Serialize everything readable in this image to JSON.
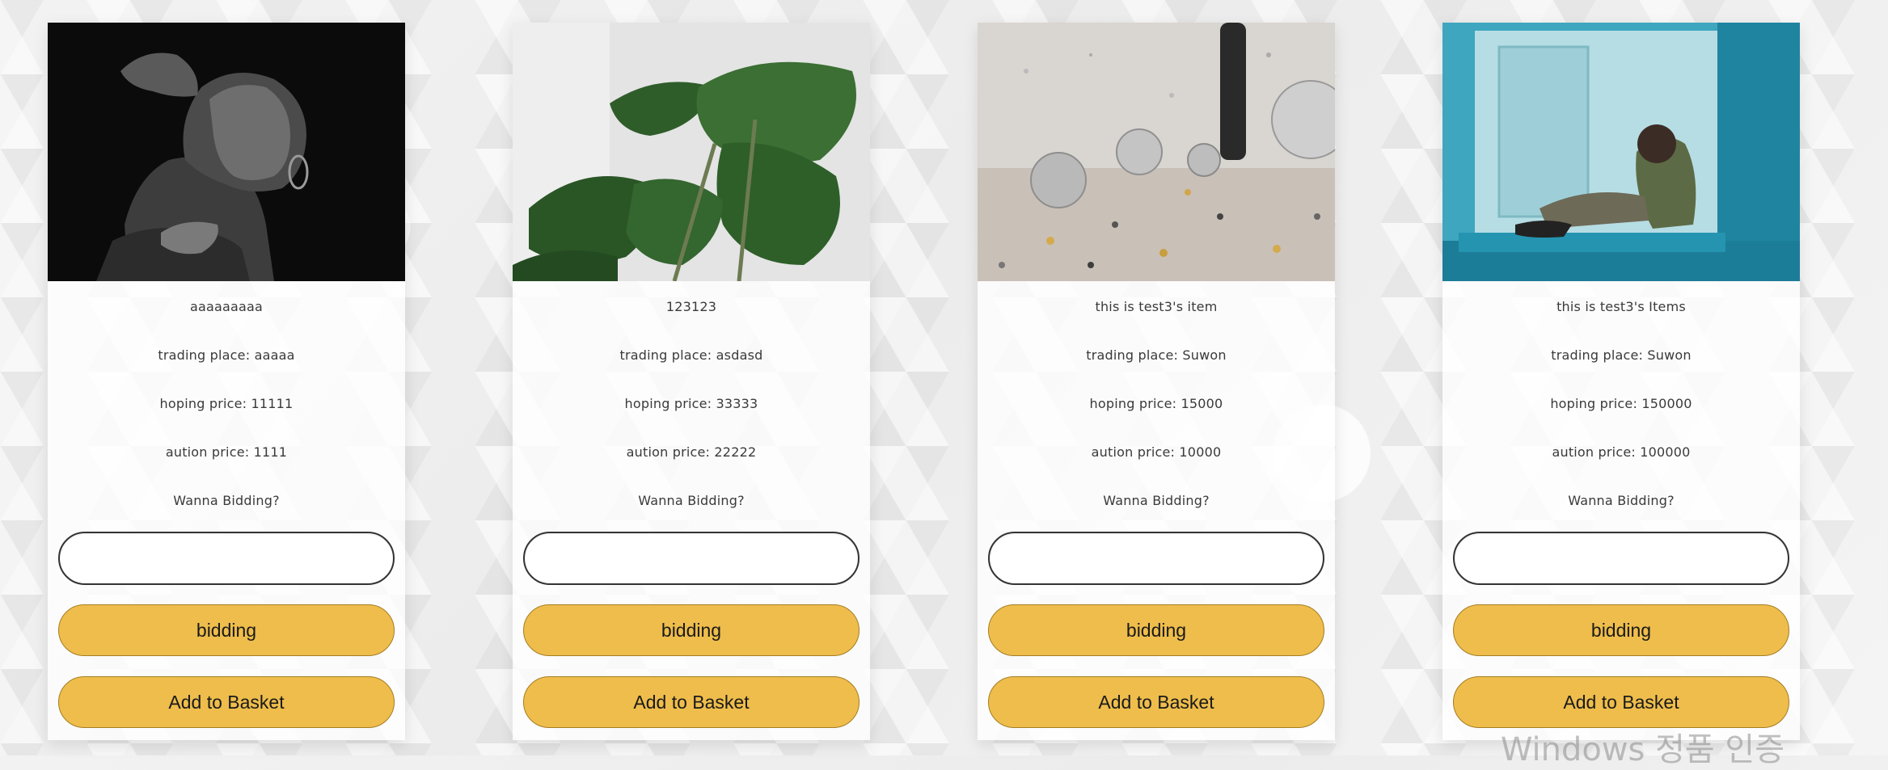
{
  "cards": [
    {
      "title": "aaaaaaaaa",
      "trading_place": "trading place: aaaaa",
      "hoping_price": "hoping price: 11111",
      "aution_price": "aution price: 1111",
      "prompt": "Wanna Bidding?",
      "bid_input_value": "",
      "bidding_label": "bidding",
      "basket_label": "Add to Basket",
      "image": "portrait-woman-monochrome"
    },
    {
      "title": "123123",
      "trading_place": "trading place: asdasd",
      "hoping_price": "hoping price: 33333",
      "aution_price": "aution price: 22222",
      "prompt": "Wanna Bidding?",
      "bid_input_value": "",
      "bidding_label": "bidding",
      "basket_label": "Add to Basket",
      "image": "monstera-plant"
    },
    {
      "title": "this is test3's item",
      "trading_place": "trading place: Suwon",
      "hoping_price": "hoping price: 15000",
      "aution_price": "aution price: 10000",
      "prompt": "Wanna Bidding?",
      "bid_input_value": "",
      "bidding_label": "bidding",
      "basket_label": "Add to Basket",
      "image": "disco-balls-confetti"
    },
    {
      "title": "this is test3's Items",
      "trading_place": "trading place: Suwon",
      "hoping_price": "hoping price: 150000",
      "aution_price": "aution price: 100000",
      "prompt": "Wanna Bidding?",
      "bid_input_value": "",
      "bidding_label": "bidding",
      "basket_label": "Add to Basket",
      "image": "woman-in-blue-room"
    }
  ],
  "watermark": "Windows 정품 인증",
  "colors": {
    "button_fill": "#eebd4b",
    "button_border": "#a67d24",
    "card_bg": "#ffffff",
    "text": "#3a3a3a"
  }
}
